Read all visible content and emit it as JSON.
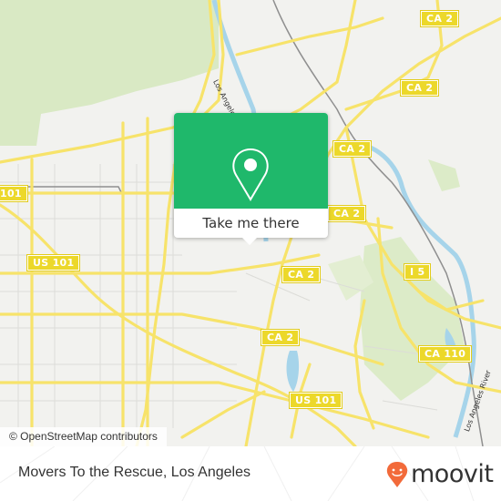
{
  "map": {
    "attribution": "© OpenStreetMap contributors",
    "colors": {
      "background": "#f2f2ef",
      "park": "#d8eac0",
      "road": "#f7e36a",
      "river": "#a6d4ea",
      "shield": "#ecd82a",
      "rail": "#888888"
    },
    "shields": [
      {
        "label": "CA 2",
        "id": "ca2-a"
      },
      {
        "label": "CA 2",
        "id": "ca2-b"
      },
      {
        "label": "CA 2",
        "id": "ca2-c"
      },
      {
        "label": "CA 2",
        "id": "ca2-d"
      },
      {
        "label": "CA 2",
        "id": "ca2-e"
      },
      {
        "label": "CA 2",
        "id": "ca2-f"
      },
      {
        "label": "101",
        "id": "us101-a"
      },
      {
        "label": "US 101",
        "id": "us101-b"
      },
      {
        "label": "US 101",
        "id": "us101-c"
      },
      {
        "label": "I 5",
        "id": "i5"
      },
      {
        "label": "CA 110",
        "id": "ca110"
      }
    ],
    "river_labels": [
      "Los Angeles River",
      "Los Angeles River"
    ]
  },
  "popup": {
    "button_label": "Take me there",
    "icon": "location-pin-icon",
    "color": "#1fb86b"
  },
  "footer": {
    "title": "Movers To the Rescue, Los Angeles",
    "brand": "moovit",
    "brand_color": "#f26a3a"
  }
}
